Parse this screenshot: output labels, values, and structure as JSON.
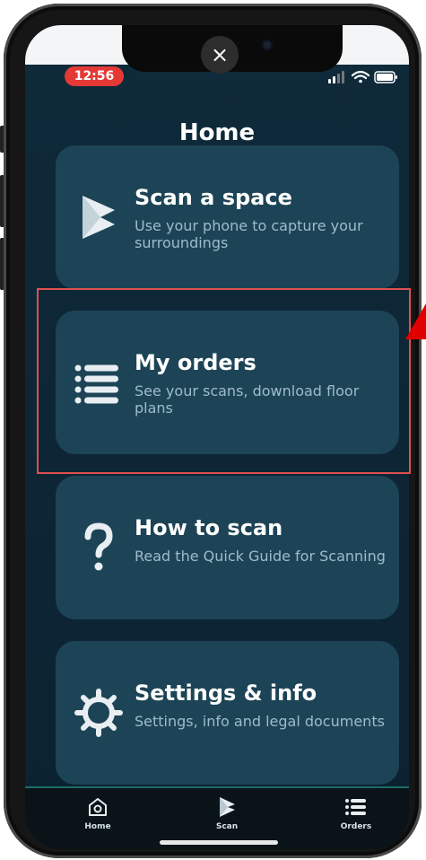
{
  "status_bar": {
    "time": "12:56"
  },
  "overlay": {
    "close_label": "×"
  },
  "header": {
    "title": "Home"
  },
  "cards": [
    {
      "id": "scan-a-space",
      "title": "Scan a space",
      "subtitle": "Use your phone to capture your surroundings",
      "icon": "scan-logo-icon"
    },
    {
      "id": "my-orders",
      "title": "My orders",
      "subtitle": "See your scans, download floor plans",
      "icon": "list-icon"
    },
    {
      "id": "how-to-scan",
      "title": "How to scan",
      "subtitle": "Read the Quick Guide for Scanning",
      "icon": "question-mark-icon"
    },
    {
      "id": "settings-info",
      "title": "Settings & info",
      "subtitle": "Settings, info and legal documents",
      "icon": "gear-icon"
    }
  ],
  "bottom_nav": [
    {
      "label": "Home",
      "icon": "home-icon"
    },
    {
      "label": "Scan",
      "icon": "scan-logo-icon"
    },
    {
      "label": "Orders",
      "icon": "list-icon"
    }
  ],
  "annotation": {
    "highlight_color": "#e05050",
    "arrow_color": "#e00000"
  },
  "colors": {
    "background": "#0f2a3a",
    "card": "#1d4456",
    "status_time": "#e53935"
  }
}
